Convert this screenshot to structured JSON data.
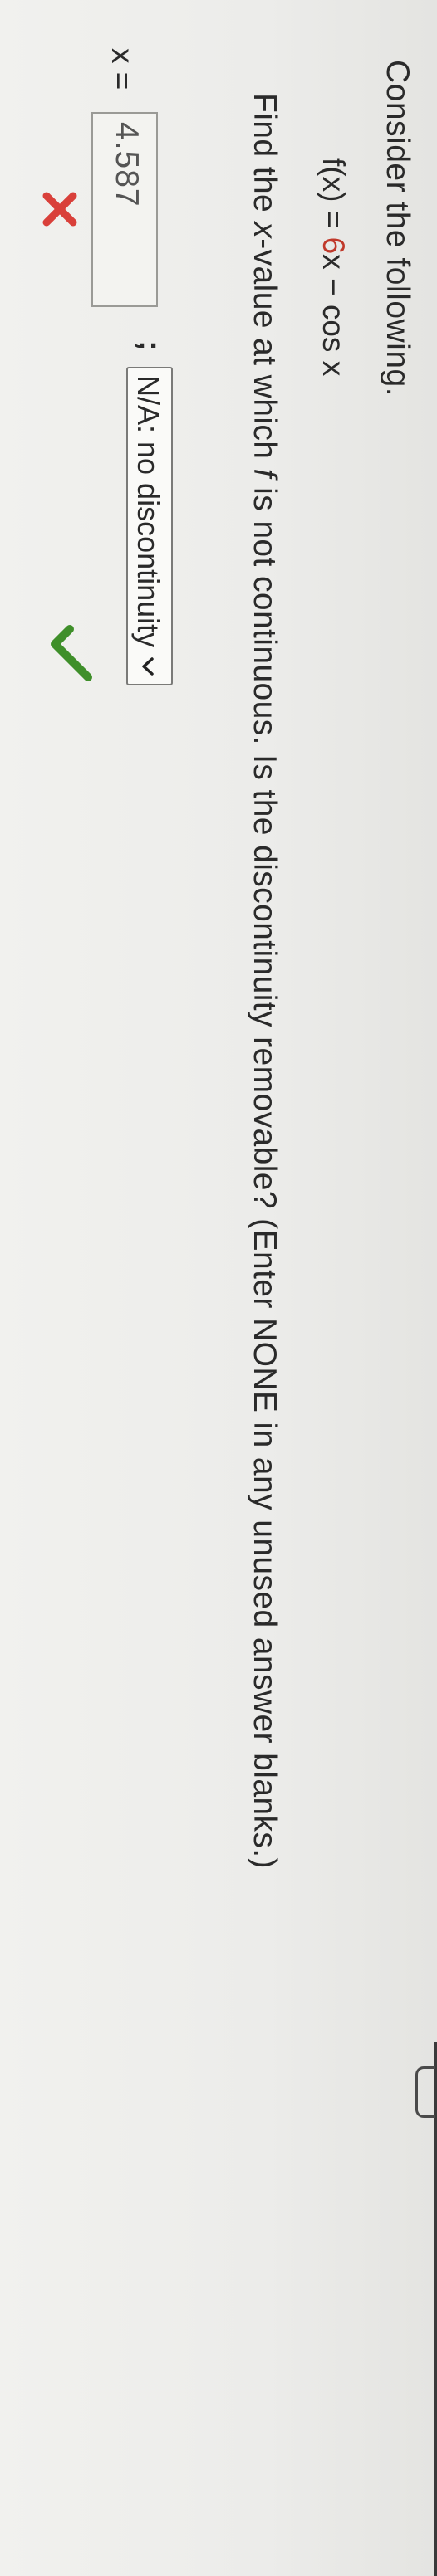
{
  "problem": {
    "heading": "Consider the following.",
    "function": {
      "lhs": "f(x) = ",
      "coef": "6",
      "rhs": "x − cos x"
    },
    "question": {
      "part1": "Find the ",
      "var": "x",
      "part2": "-value at which ",
      "fname": "f",
      "part3": " is not continuous. Is the discontinuity removable? (Enter NONE in any unused answer blanks.)"
    }
  },
  "answer": {
    "label": "x = ",
    "value": "4.587",
    "status": "incorrect"
  },
  "separator": ";",
  "removable_select": {
    "selected": "N/A: no discontinuity",
    "status": "correct"
  },
  "colors": {
    "coefficient": "#c0392b",
    "incorrect": "#d9403a",
    "correct": "#3f8f2a"
  }
}
